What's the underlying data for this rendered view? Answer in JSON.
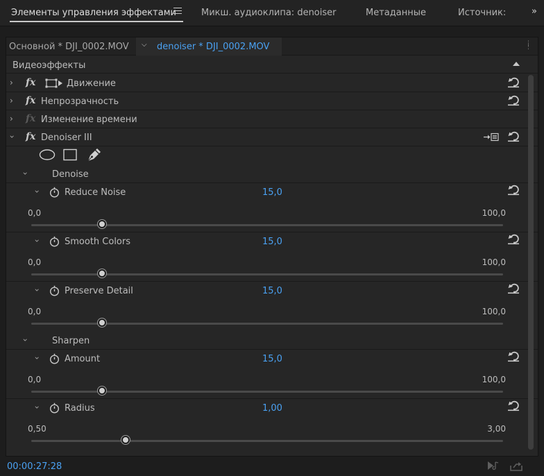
{
  "tabs": [
    {
      "label": "Элементы управления эффектами",
      "active": true
    },
    {
      "label": "Микш. аудиоклипа: denoiser",
      "active": false
    },
    {
      "label": "Метаданные",
      "active": false
    },
    {
      "label": "Источник: ",
      "active": false
    }
  ],
  "overflow_label": "»",
  "sequence": {
    "master": "Основной * DJI_0002.MOV",
    "clip": "denoiser * DJI_0002.MOV",
    "chevron": "⌵"
  },
  "section": {
    "title": "Видеоэффекты"
  },
  "effects": [
    {
      "label": "Движение",
      "expanded": false,
      "enabled": true
    },
    {
      "label": "Непрозрачность",
      "expanded": false,
      "enabled": true
    },
    {
      "label": "Изменение времени",
      "expanded": false,
      "enabled": false
    },
    {
      "label": "Denoiser III",
      "expanded": true,
      "enabled": true
    }
  ],
  "fx_glyph": "fx",
  "twisty_glyph": "›",
  "groups": [
    {
      "label": "Denoise"
    },
    {
      "label": "Sharpen"
    }
  ],
  "params": [
    {
      "label": "Reduce Noise",
      "value": "15,0",
      "min": "0,0",
      "max": "100,0",
      "fraction": 0.15
    },
    {
      "label": "Smooth Colors",
      "value": "15,0",
      "min": "0,0",
      "max": "100,0",
      "fraction": 0.15
    },
    {
      "label": "Preserve Detail",
      "value": "15,0",
      "min": "0,0",
      "max": "100,0",
      "fraction": 0.15
    },
    {
      "label": "Amount",
      "value": "15,0",
      "min": "0,0",
      "max": "100,0",
      "fraction": 0.15
    },
    {
      "label": "Radius",
      "value": "1,00",
      "min": "0,50",
      "max": "3,00",
      "fraction": 0.2
    }
  ],
  "status": {
    "timecode": "00:00:27:28"
  },
  "colors": {
    "accent": "#4aa1f2",
    "panel": "#262626",
    "text": "#bdbdbd"
  }
}
